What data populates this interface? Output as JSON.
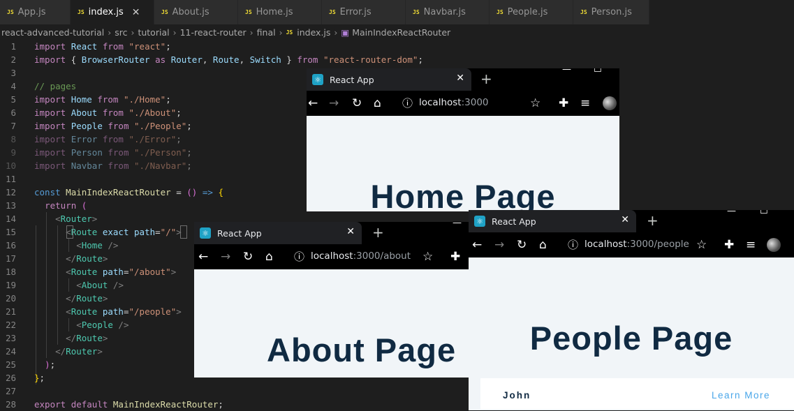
{
  "editor": {
    "tabs": [
      {
        "icon": "JS",
        "label": "App.js"
      },
      {
        "icon": "JS",
        "label": "index.js"
      },
      {
        "icon": "JS",
        "label": "About.js"
      },
      {
        "icon": "JS",
        "label": "Home.js"
      },
      {
        "icon": "JS",
        "label": "Error.js"
      },
      {
        "icon": "JS",
        "label": "Navbar.js"
      },
      {
        "icon": "JS",
        "label": "People.js"
      },
      {
        "icon": "JS",
        "label": "Person.js"
      }
    ],
    "active_tab_close": "✕",
    "breadcrumb": [
      "react-advanced-tutorial",
      "src",
      "tutorial",
      "11-react-router",
      "final",
      "index.js",
      "MainIndexReactRouter"
    ],
    "breadcrumb_sep": "›",
    "line_numbers": [
      "1",
      "2",
      "3",
      "4",
      "5",
      "6",
      "7",
      "8",
      "9",
      "10",
      "11",
      "12",
      "13",
      "14",
      "15",
      "16",
      "17",
      "18",
      "19",
      "20",
      "21",
      "22",
      "23",
      "24",
      "25",
      "26",
      "27",
      "28"
    ],
    "code": {
      "l1": [
        "import",
        " ",
        "React",
        " ",
        "from",
        " ",
        "\"react\"",
        ";"
      ],
      "l2": [
        "import",
        " { ",
        "BrowserRouter",
        " ",
        "as",
        " ",
        "Router",
        ", ",
        "Route",
        ", ",
        "Switch",
        " } ",
        "from",
        " ",
        "\"react-router-dom\"",
        ";"
      ],
      "l4": [
        "// pages"
      ],
      "l5": [
        "import",
        " ",
        "Home",
        " ",
        "from",
        " ",
        "\"./Home\"",
        ";"
      ],
      "l6": [
        "import",
        " ",
        "About",
        " ",
        "from",
        " ",
        "\"./About\"",
        ";"
      ],
      "l7": [
        "import",
        " ",
        "People",
        " ",
        "from",
        " ",
        "\"./People\"",
        ";"
      ],
      "l8": [
        "import",
        " ",
        "Error",
        " ",
        "from",
        " ",
        "\"./Error\"",
        ";"
      ],
      "l9": [
        "import",
        " ",
        "Person",
        " ",
        "from",
        " ",
        "\"./Person\"",
        ";"
      ],
      "l10": [
        "import",
        " ",
        "Navbar",
        " ",
        "from",
        " ",
        "\"./Navbar\"",
        ";"
      ],
      "l12": [
        "const",
        " ",
        "MainIndexReactRouter",
        " = ",
        "()",
        " ",
        "=>",
        " ",
        "{"
      ],
      "l13": [
        "return",
        " ",
        "("
      ],
      "l14": [
        "<",
        "Router",
        ">"
      ],
      "l15": [
        "<",
        "Route",
        " ",
        "exact",
        " ",
        "path",
        "=",
        "\"/\"",
        ">"
      ],
      "l16": [
        "<",
        "Home",
        " />"
      ],
      "l17": [
        "</",
        "Route",
        ">"
      ],
      "l18": [
        "<",
        "Route",
        " ",
        "path",
        "=",
        "\"/about\"",
        ">"
      ],
      "l19": [
        "<",
        "About",
        " />"
      ],
      "l20": [
        "</",
        "Route",
        ">"
      ],
      "l21": [
        "<",
        "Route",
        " ",
        "path",
        "=",
        "\"/people\"",
        ">"
      ],
      "l22": [
        "<",
        "People",
        " />"
      ],
      "l23": [
        "</",
        "Route",
        ">"
      ],
      "l24": [
        "</",
        "Router",
        ">"
      ],
      "l25": [
        ")",
        ";"
      ],
      "l26": [
        "}",
        ";"
      ],
      "l28": [
        "export",
        " ",
        "default",
        " ",
        "MainIndexReactRouter",
        ";"
      ]
    }
  },
  "browsers": {
    "home": {
      "tab_title": "React App",
      "url_host": "localhost",
      "url_rest": ":3000",
      "heading": "Home Page"
    },
    "about": {
      "tab_title": "React App",
      "url_host": "localhost",
      "url_rest": ":3000/about",
      "heading": "About Page"
    },
    "people": {
      "tab_title": "React App",
      "url_host": "localhost",
      "url_rest": ":3000/people",
      "heading": "People Page",
      "person": {
        "name": "John",
        "link": "Learn More"
      }
    }
  },
  "icons": {
    "close": "✕",
    "new_tab": "+",
    "minimize": "—",
    "maximize": "☐",
    "back": "←",
    "forward": "→",
    "reload": "↻",
    "home": "⌂",
    "info": "ⓘ",
    "star": "☆",
    "extensions": "✚",
    "media": "≡",
    "react": "⚛"
  }
}
